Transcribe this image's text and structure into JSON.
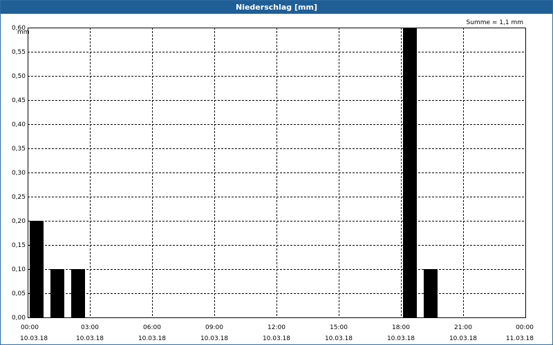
{
  "window": {
    "title": "Niederschlag [mm]"
  },
  "chart_data": {
    "type": "bar",
    "title": "Niederschlag [mm]",
    "ylabel": "mm",
    "annotation": "Summe = 1,1 mm",
    "ylim": [
      0,
      0.6
    ],
    "y_ticks": [
      "0,00",
      "0,05",
      "0,10",
      "0,15",
      "0,20",
      "0,25",
      "0,30",
      "0,35",
      "0,40",
      "0,45",
      "0,50",
      "0,55",
      "0,60"
    ],
    "x_range_hours": [
      0,
      24
    ],
    "x_ticks": [
      {
        "time": "00:00",
        "date": "10.03.18"
      },
      {
        "time": "03:00",
        "date": "10.03.18"
      },
      {
        "time": "06:00",
        "date": "10.03.18"
      },
      {
        "time": "09:00",
        "date": "10.03.18"
      },
      {
        "time": "12:00",
        "date": "10.03.18"
      },
      {
        "time": "15:00",
        "date": "10.03.18"
      },
      {
        "time": "18:00",
        "date": "10.03.18"
      },
      {
        "time": "21:00",
        "date": "10.03.18"
      },
      {
        "time": "00:00",
        "date": "11.03.18"
      }
    ],
    "bars": [
      {
        "start": "00:00",
        "end": "01:00",
        "value": 0.2
      },
      {
        "start": "01:00",
        "end": "02:00",
        "value": 0.1
      },
      {
        "start": "02:00",
        "end": "03:00",
        "value": 0.1
      },
      {
        "start": "18:00",
        "end": "19:00",
        "value": 0.6
      },
      {
        "start": "19:00",
        "end": "20:00",
        "value": 0.1
      }
    ],
    "bar_color": "#000000",
    "grid": true
  }
}
